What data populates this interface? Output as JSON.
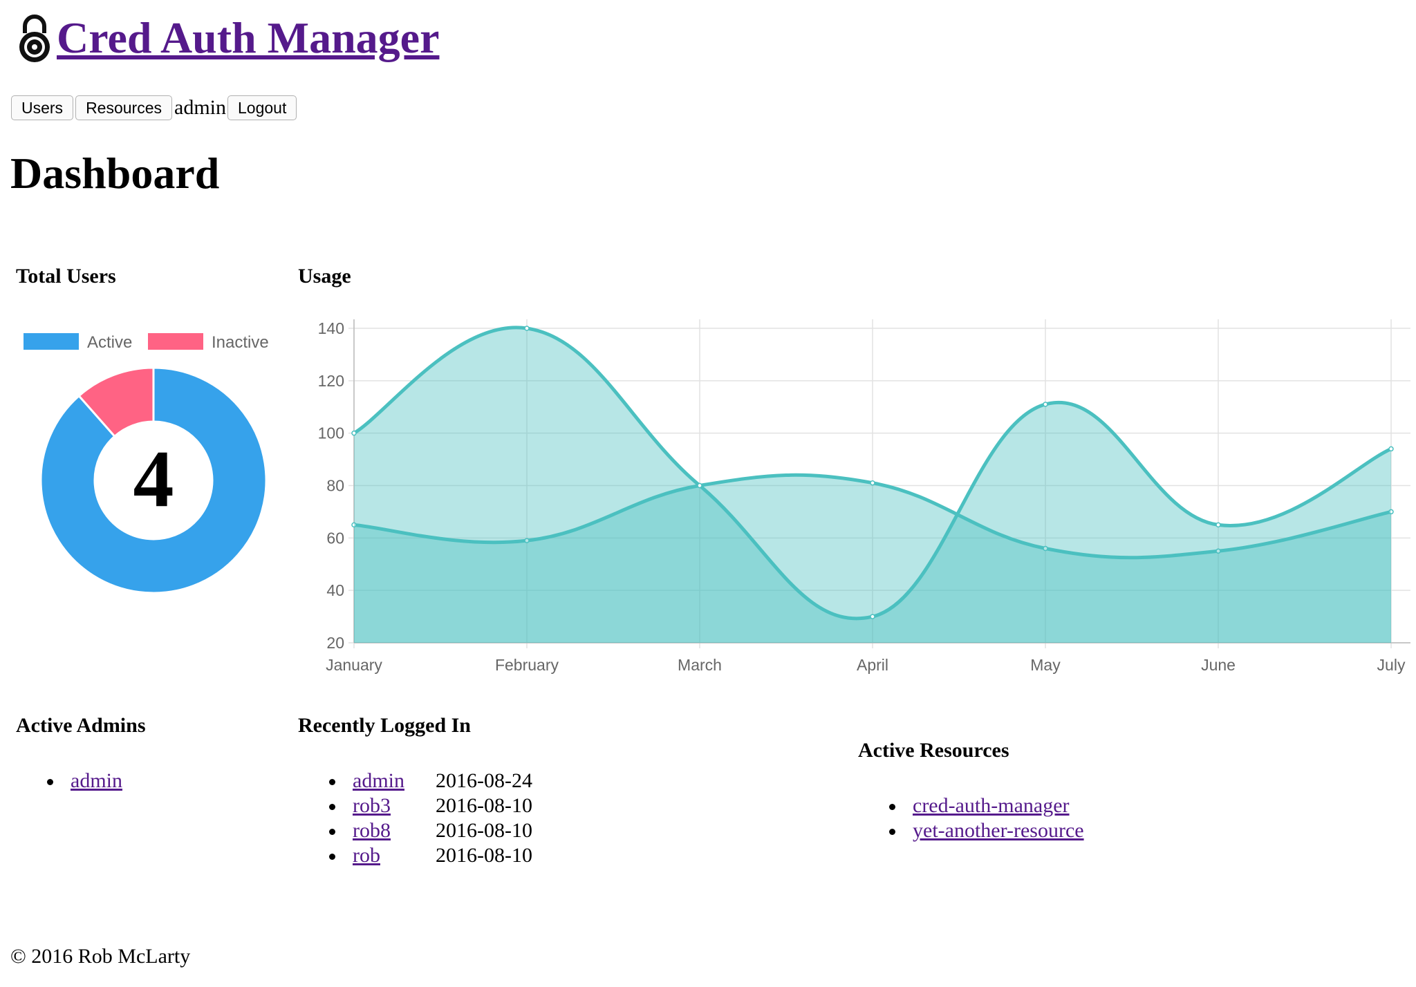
{
  "header": {
    "title": "Cred Auth Manager",
    "logo_icon": "lock-icon"
  },
  "nav": {
    "users_label": "Users",
    "resources_label": "Resources",
    "current_user": "admin",
    "logout_label": "Logout"
  },
  "page": {
    "title": "Dashboard"
  },
  "total_users": {
    "heading": "Total Users",
    "count": "4",
    "legend": [
      {
        "label": "Active",
        "color": "#36A2EB"
      },
      {
        "label": "Inactive",
        "color": "#FF6384"
      }
    ]
  },
  "chart_data": [
    {
      "type": "pie",
      "title": "Total Users",
      "categories": [
        "Active",
        "Inactive"
      ],
      "values": [
        0.885,
        0.115
      ],
      "colors": [
        "#36A2EB",
        "#FF6384"
      ],
      "center_label": "4",
      "legend_position": "top"
    },
    {
      "type": "area",
      "title": "Usage",
      "categories": [
        "January",
        "February",
        "March",
        "April",
        "May",
        "June",
        "July"
      ],
      "series": [
        {
          "values": [
            65,
            59,
            80,
            81,
            56,
            55,
            70
          ]
        },
        {
          "values": [
            100,
            140,
            80,
            30,
            111,
            65,
            94
          ]
        }
      ],
      "ylim": [
        20,
        140
      ],
      "yticks": [
        20,
        40,
        60,
        80,
        100,
        120,
        140
      ],
      "grid": true,
      "colors": {
        "line": "#4BC0C0",
        "fill": "rgba(75,192,192,0.4)"
      }
    }
  ],
  "usage": {
    "heading": "Usage"
  },
  "active_admins": {
    "heading": "Active Admins",
    "items": [
      "admin"
    ]
  },
  "recently_logged_in": {
    "heading": "Recently Logged In",
    "items": [
      {
        "user": "admin",
        "date": "2016-08-24"
      },
      {
        "user": "rob3",
        "date": "2016-08-10"
      },
      {
        "user": "rob8",
        "date": "2016-08-10"
      },
      {
        "user": "rob",
        "date": "2016-08-10"
      }
    ]
  },
  "active_resources": {
    "heading": "Active Resources",
    "items": [
      "cred-auth-manager",
      "yet-another-resource"
    ]
  },
  "footer": {
    "text": "© 2016 Rob McLarty"
  }
}
